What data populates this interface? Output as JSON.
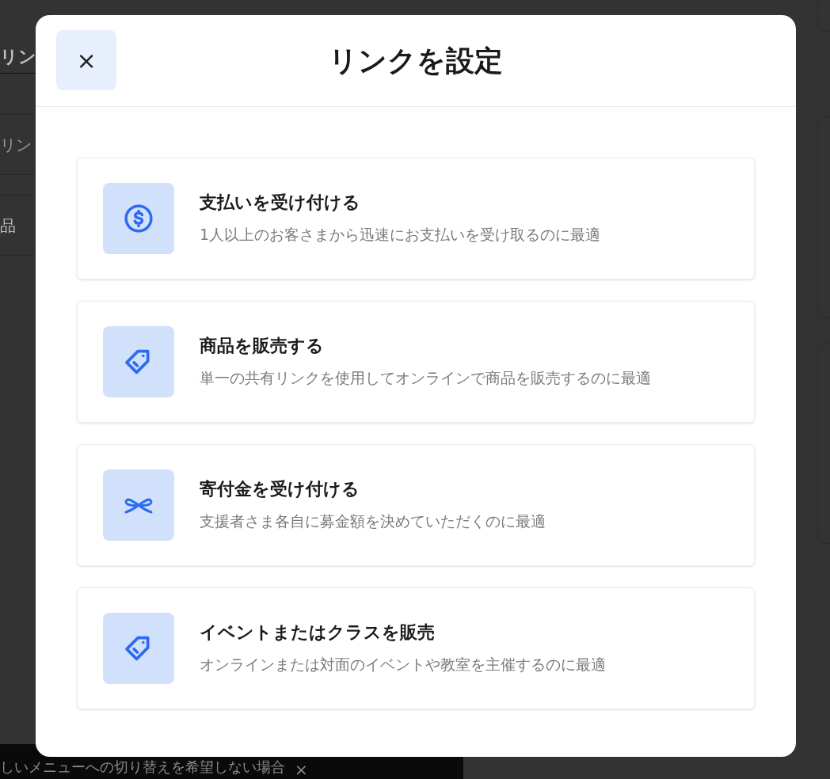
{
  "background": {
    "heading": "リン",
    "field_placeholder": "リン",
    "row_label": "品",
    "banner": {
      "text": "しいメニューへの切り替えを希望しない場合",
      "close": "×"
    }
  },
  "dialog": {
    "title": "リンクを設定",
    "close": "×",
    "options": [
      {
        "kind": "dollar",
        "title": "支払いを受け付ける",
        "description": "1人以上のお客さまから迅速にお支払いを受け取るのに最適"
      },
      {
        "kind": "tag",
        "title": "商品を販売する",
        "description": "単一の共有リンクを使用してオンラインで商品を販売するのに最適"
      },
      {
        "kind": "ribbon",
        "title": "寄付金を受け付ける",
        "description": "支援者さま各自に募金額を決めていただくのに最適"
      },
      {
        "kind": "tag",
        "title": "イベントまたはクラスを販売",
        "description": "オンラインまたは対面のイベントや教室を主催するのに最適"
      }
    ]
  }
}
